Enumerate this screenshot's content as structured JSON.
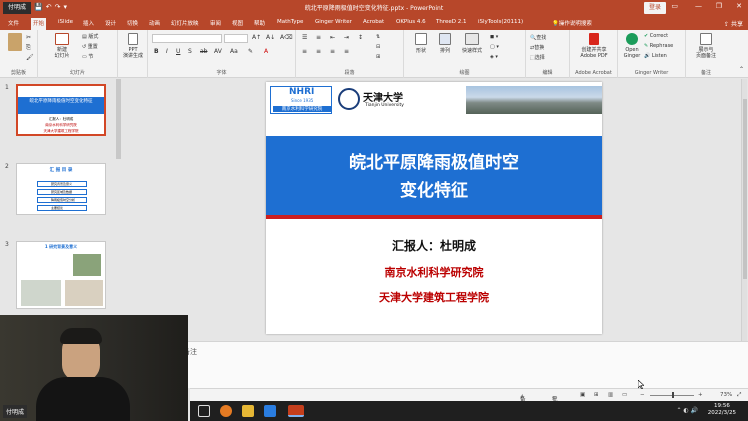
{
  "window": {
    "doc_title": "皖北平原降雨极值时空变化特征.pptx - PowerPoint",
    "user_badge": "付明成",
    "signin_label": "登录",
    "controls": [
      "—",
      "❐",
      "✕"
    ]
  },
  "tabs": [
    {
      "label": "文件"
    },
    {
      "label": "开始",
      "active": true
    },
    {
      "label": "iSlide"
    },
    {
      "label": "插入"
    },
    {
      "label": "设计"
    },
    {
      "label": "切换"
    },
    {
      "label": "动画"
    },
    {
      "label": "幻灯片放映"
    },
    {
      "label": "审阅"
    },
    {
      "label": "视图"
    },
    {
      "label": "帮助"
    },
    {
      "label": "MathType"
    },
    {
      "label": "Ginger Writer"
    },
    {
      "label": "Acrobat"
    },
    {
      "label": "OKPlus 4.6"
    },
    {
      "label": "ThreeD 2.1"
    },
    {
      "label": "iSlyTools(20111)"
    },
    {
      "label": "操作说明搜索"
    }
  ],
  "share_label": "共享",
  "ribbon": {
    "groups": [
      {
        "label": "剪贴板"
      },
      {
        "label": "幻灯片"
      },
      {
        "label": ""
      },
      {
        "label": "字体"
      },
      {
        "label": "段落"
      },
      {
        "label": "绘图"
      },
      {
        "label": "编辑"
      },
      {
        "label": "Adobe Acrobat"
      },
      {
        "label": "Ginger Writer"
      },
      {
        "label": "备注"
      }
    ],
    "buttons": {
      "new_slide": "新建\n幻灯片",
      "layout": "版式",
      "reset": "重置",
      "section": "节",
      "ppt_gen": "PPT\n演讲生成",
      "shape": "形状",
      "arrange": "排列",
      "quick_style": "快速样式",
      "find": "查找",
      "replace": "替换",
      "select": "选择",
      "adobe_pdf": "创建并共享\nAdobe PDF",
      "open_ginger": "Open\nGinger",
      "correct": "Correct",
      "rephrase": "Rephrase",
      "listen": "Listen",
      "notes_btn": "展示与\n页面备注"
    }
  },
  "thumbnails": [
    {
      "num": "1",
      "title": "皖北平原降雨极值时空变化特征",
      "lines": [
        "汇报人：杜明成",
        "南京水利科学研究院",
        "天津大学建筑工程学院"
      ]
    },
    {
      "num": "2",
      "title": "汇 报 目 录",
      "items": [
        "研究背景及意义",
        "研究区域及数据",
        "降雨极值时空分析",
        "主要结论"
      ]
    },
    {
      "num": "3",
      "title": "1 研究背景及意义"
    }
  ],
  "slide": {
    "logo_nhri": "NHRI",
    "logo_nhri_since": "Since 1935",
    "logo_nhri_cn": "南京水利科学研究院",
    "logo_tju": "天津大学",
    "logo_tju_en": "Tianjin University",
    "title_line1": "皖北平原降雨极值时空",
    "title_line2": "变化特征",
    "reporter": "汇报人：杜明成",
    "institution1": "南京水利科学研究院",
    "institution2": "天津大学建筑工程学院"
  },
  "notes_label": "备注",
  "status": {
    "notes": "备注",
    "comments": "批注",
    "zoom": "73%"
  },
  "taskbar": {
    "time": "19:56",
    "date": "2022/3/25"
  },
  "webcam": {
    "name": "付明成"
  },
  "colors": {
    "accent": "#b7472a",
    "slide_blue": "#1e6fd2",
    "slide_red": "#cc1f1f",
    "institution_red": "#bb0000"
  }
}
